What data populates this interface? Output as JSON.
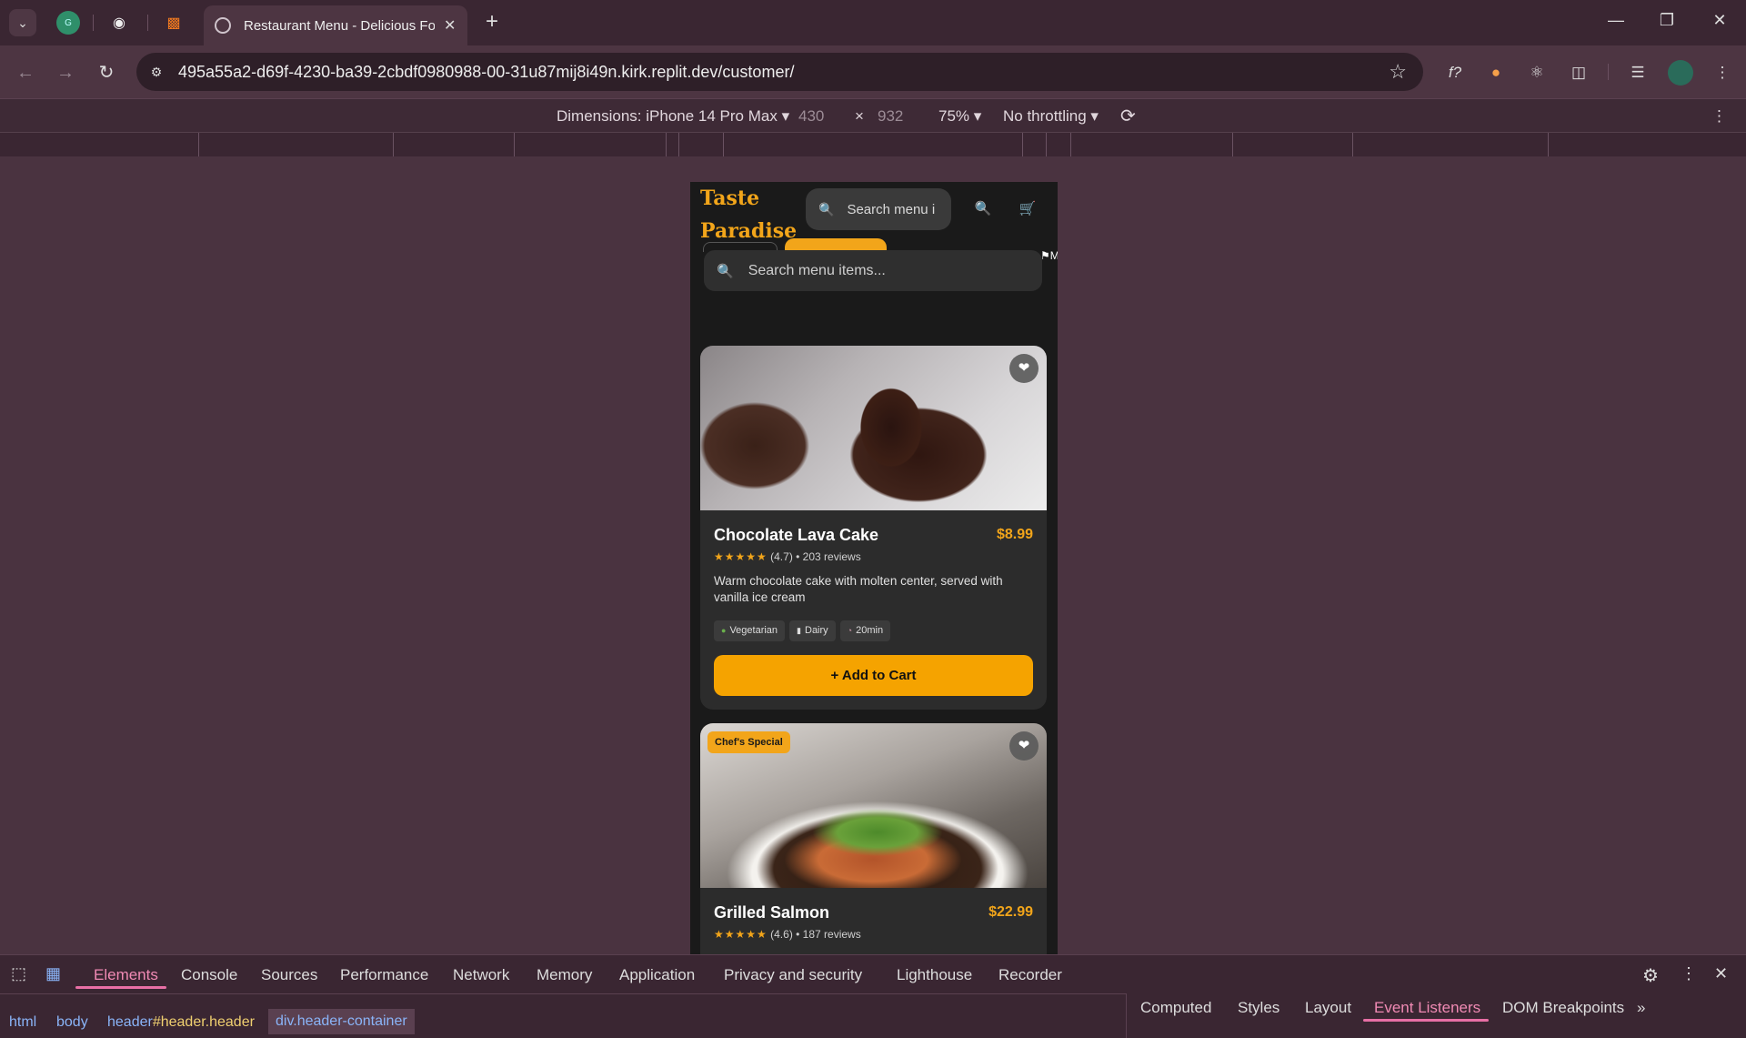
{
  "browser": {
    "tab_title": "Restaurant Menu - Delicious Fo",
    "new_tab": "+",
    "url": "495a55a2-d69f-4230-ba39-2cbdf0980988-00-31u87mij8i49n.kirk.replit.dev/customer/",
    "window_controls": [
      "minimize",
      "restore",
      "close"
    ]
  },
  "device_toolbar": {
    "dimensions_label": "Dimensions: iPhone 14 Pro Max",
    "width": "430",
    "times": "×",
    "height": "932",
    "zoom": "75%",
    "throttling": "No throttling"
  },
  "app": {
    "brand_line1": "Taste",
    "brand_line2": "Paradise",
    "header_search_placeholder": "Search menu i",
    "search_placeholder": "Search menu items...",
    "corner_text": "M",
    "accent": "#f2a51a",
    "cards": [
      {
        "name": "Chocolate Lava Cake",
        "price": "$8.99",
        "stars": "★★★★★",
        "rating": "(4.7) • 203 reviews",
        "description": "Warm chocolate cake with molten center, served with vanilla ice cream",
        "tags": [
          {
            "icon": "leaf-icon",
            "label": "Vegetarian"
          },
          {
            "icon": "milk-icon",
            "label": "Dairy"
          },
          {
            "icon": "clock-icon",
            "label": "20min"
          }
        ],
        "button": "+ Add to Cart"
      },
      {
        "badge": "Chef's Special",
        "name": "Grilled Salmon",
        "price": "$22.99",
        "stars": "★★★★★",
        "rating": "(4.6) • 187 reviews"
      }
    ]
  },
  "devtools": {
    "tabs": [
      "Elements",
      "Console",
      "Sources",
      "Performance",
      "Network",
      "Memory",
      "Application",
      "Privacy and security",
      "Lighthouse",
      "Recorder"
    ],
    "active_tab": "Elements",
    "breadcrumbs": [
      "html",
      "body",
      "header#header.header",
      "div.header-container"
    ],
    "crumb_header_tag": "header",
    "crumb_header_rest": "#header.header",
    "right_tabs": [
      "Computed",
      "Styles",
      "Layout",
      "Event Listeners",
      "DOM Breakpoints"
    ],
    "right_active": "Event Listeners"
  }
}
